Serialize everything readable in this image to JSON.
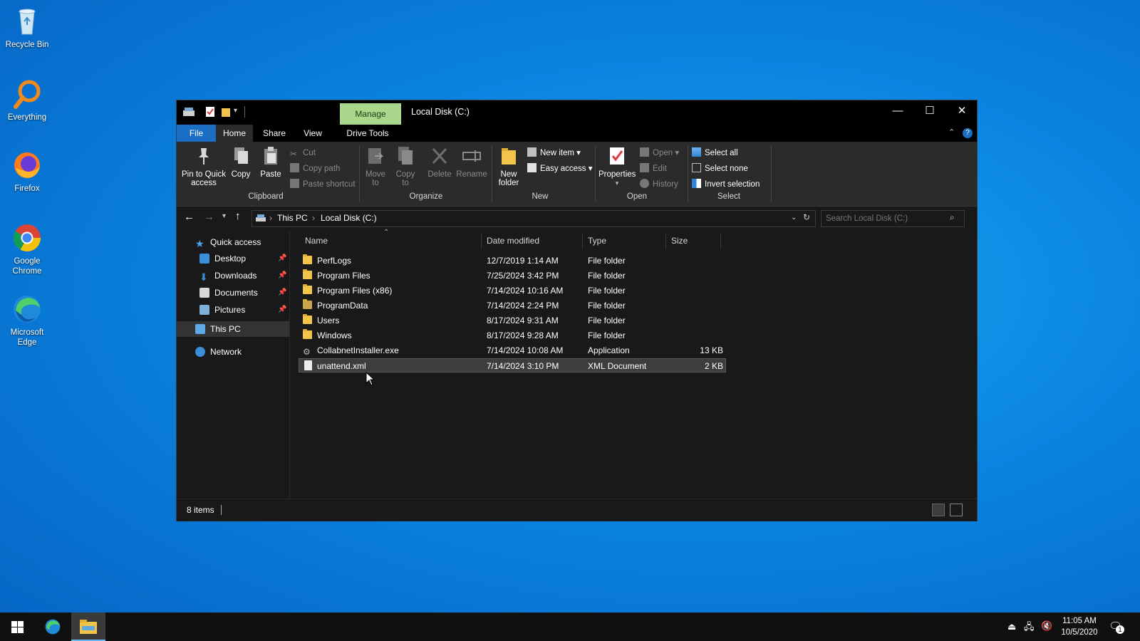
{
  "desktop": {
    "icons": [
      {
        "label": "Recycle Bin",
        "icon": "recycle-bin-icon"
      },
      {
        "label": "Everything",
        "icon": "everything-search-icon"
      },
      {
        "label": "Firefox",
        "icon": "firefox-icon"
      },
      {
        "label": "Google Chrome",
        "icon": "chrome-icon"
      },
      {
        "label": "Microsoft Edge",
        "icon": "edge-icon"
      }
    ]
  },
  "window": {
    "title": "Local Disk (C:)",
    "contextual_tab": "Manage",
    "quick_access_toolbar": [
      "properties-icon",
      "new-folder-icon",
      "customize-dropdown-icon"
    ],
    "controls": {
      "minimize": "—",
      "maximize": "☐",
      "close": "✕"
    }
  },
  "ribbon_tabs": [
    "File",
    "Home",
    "Share",
    "View",
    "Drive Tools"
  ],
  "ribbon": {
    "clipboard": {
      "label": "Clipboard",
      "pin": "Pin to Quick access",
      "copy": "Copy",
      "paste": "Paste",
      "cut": "Cut",
      "copy_path": "Copy path",
      "paste_shortcut": "Paste shortcut"
    },
    "organize": {
      "label": "Organize",
      "move_to": "Move to",
      "copy_to": "Copy to",
      "delete": "Delete",
      "rename": "Rename"
    },
    "new": {
      "label": "New",
      "new_folder": "New folder",
      "new_item": "New item",
      "easy_access": "Easy access"
    },
    "open": {
      "label": "Open",
      "properties": "Properties",
      "open": "Open",
      "edit": "Edit",
      "history": "History"
    },
    "select": {
      "label": "Select",
      "select_all": "Select all",
      "select_none": "Select none",
      "invert": "Invert selection"
    }
  },
  "address": {
    "breadcrumbs": [
      "This PC",
      "Local Disk (C:)"
    ],
    "search_placeholder": "Search Local Disk (C:)"
  },
  "nav": {
    "quick_access": "Quick access",
    "pinned": [
      "Desktop",
      "Downloads",
      "Documents",
      "Pictures"
    ],
    "this_pc": "This PC",
    "network": "Network"
  },
  "columns": [
    "Name",
    "Date modified",
    "Type",
    "Size"
  ],
  "files": [
    {
      "name": "PerfLogs",
      "date": "12/7/2019 1:14 AM",
      "type": "File folder",
      "size": "",
      "kind": "folder"
    },
    {
      "name": "Program Files",
      "date": "7/25/2024 3:42 PM",
      "type": "File folder",
      "size": "",
      "kind": "folder"
    },
    {
      "name": "Program Files (x86)",
      "date": "7/14/2024 10:16 AM",
      "type": "File folder",
      "size": "",
      "kind": "folder"
    },
    {
      "name": "ProgramData",
      "date": "7/14/2024 2:24 PM",
      "type": "File folder",
      "size": "",
      "kind": "folder"
    },
    {
      "name": "Users",
      "date": "8/17/2024 9:31 AM",
      "type": "File folder",
      "size": "",
      "kind": "folder"
    },
    {
      "name": "Windows",
      "date": "8/17/2024 9:28 AM",
      "type": "File folder",
      "size": "",
      "kind": "folder"
    },
    {
      "name": "CollabnetInstaller.exe",
      "date": "7/14/2024 10:08 AM",
      "type": "Application",
      "size": "13 KB",
      "kind": "exe"
    },
    {
      "name": "unattend.xml",
      "date": "7/14/2024 3:10 PM",
      "type": "XML Document",
      "size": "2 KB",
      "kind": "xml"
    }
  ],
  "status": {
    "items": "8 items"
  },
  "taskbar": {
    "time": "11:05 AM",
    "date": "10/5/2020",
    "notification_count": "1"
  },
  "colors": {
    "accent": "#1a6fc4",
    "manage_tab": "#a9d88d",
    "folder": "#f2c449",
    "window_bg": "#191919",
    "ribbon_bg": "#2b2b2b"
  }
}
